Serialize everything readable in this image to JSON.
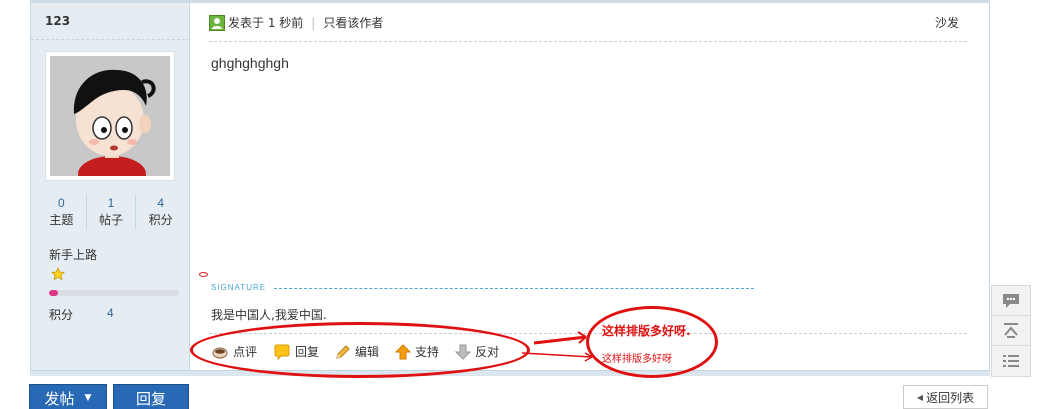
{
  "author": {
    "name": "123"
  },
  "stats": [
    {
      "num": "0",
      "label": "主题"
    },
    {
      "num": "1",
      "label": "帖子"
    },
    {
      "num": "4",
      "label": "积分"
    }
  ],
  "rank": {
    "title": "新手上路",
    "progress_percent": 7
  },
  "points": {
    "label": "积分",
    "value": "4"
  },
  "post": {
    "meta_posted": "发表于 1 秒前",
    "meta_only_author": "只看该作者",
    "floor": "沙发",
    "message": "ghghghghgh",
    "signature_label": "SIGNATURE",
    "signature_text": "我是中国人,我爱中国."
  },
  "actions": [
    {
      "label": "点评",
      "icon": "comment-cup-icon"
    },
    {
      "label": "回复",
      "icon": "reply-bubble-icon"
    },
    {
      "label": "编辑",
      "icon": "pencil-icon"
    },
    {
      "label": "支持",
      "icon": "arrow-up-icon"
    },
    {
      "label": "反对",
      "icon": "arrow-down-icon"
    }
  ],
  "footer": {
    "post_button": "发帖",
    "reply_button": "回复",
    "back_to_list": "返回列表"
  },
  "annotations": {
    "note_bold": "这样排版多好呀.",
    "note_small": "这样排版多好呀"
  },
  "colors": {
    "accent_blue": "#2869b5",
    "annotation_red": "#e01010",
    "sidebar_bg": "#e5edf2"
  }
}
